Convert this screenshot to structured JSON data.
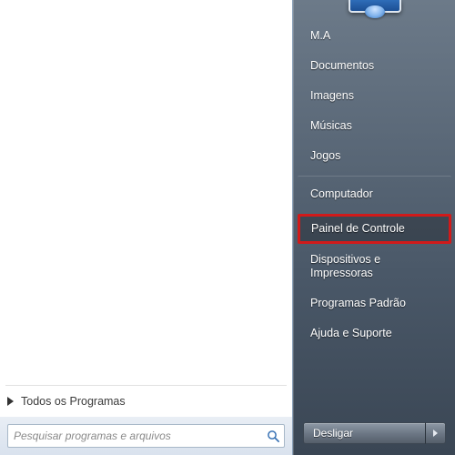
{
  "allPrograms": "Todos os Programas",
  "search": {
    "placeholder": "Pesquisar programas e arquivos"
  },
  "right": {
    "user": "M.A",
    "items": [
      {
        "label": "Documentos"
      },
      {
        "label": "Imagens"
      },
      {
        "label": "Músicas"
      },
      {
        "label": "Jogos"
      },
      {
        "label": "Computador"
      },
      {
        "label": "Painel de Controle",
        "highlight": true,
        "sep": true
      },
      {
        "label": "Dispositivos e Impressoras"
      },
      {
        "label": "Programas Padrão"
      },
      {
        "label": "Ajuda e Suporte"
      }
    ]
  },
  "shutdown": {
    "label": "Desligar"
  },
  "colors": {
    "highlightBorder": "#d11a1a",
    "rightBgTop": "#6c7a89",
    "rightBgBottom": "#3a4654"
  }
}
